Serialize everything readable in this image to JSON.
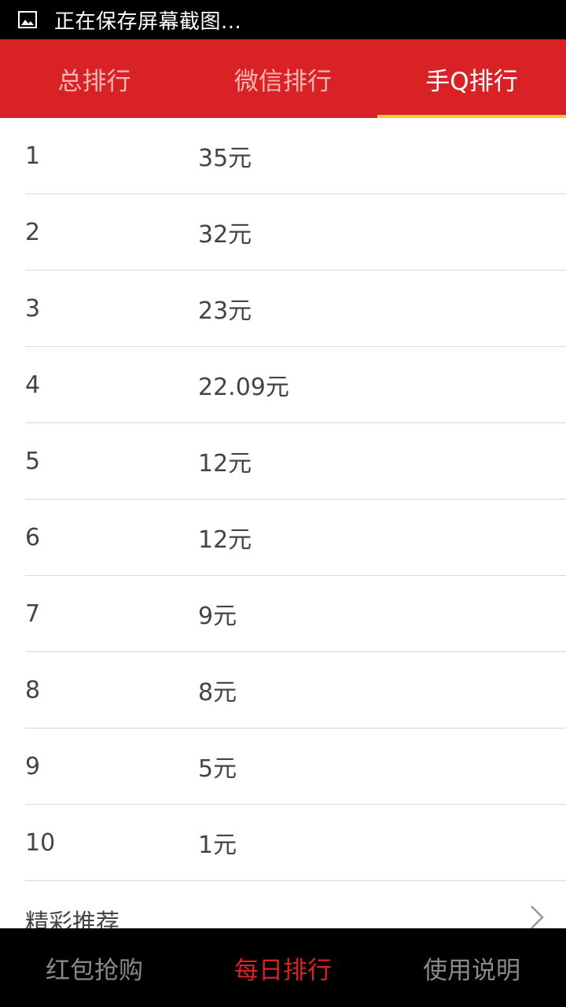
{
  "status_bar": {
    "icon": "image-icon",
    "text": "正在保存屏幕截图..."
  },
  "tabs": [
    {
      "label": "总排行",
      "active": false
    },
    {
      "label": "微信排行",
      "active": false
    },
    {
      "label": "手Q排行",
      "active": true
    }
  ],
  "ranking": [
    {
      "rank": "1",
      "amount": "35元"
    },
    {
      "rank": "2",
      "amount": "32元"
    },
    {
      "rank": "3",
      "amount": "23元"
    },
    {
      "rank": "4",
      "amount": "22.09元"
    },
    {
      "rank": "5",
      "amount": "12元"
    },
    {
      "rank": "6",
      "amount": "12元"
    },
    {
      "rank": "7",
      "amount": "9元"
    },
    {
      "rank": "8",
      "amount": "8元"
    },
    {
      "rank": "9",
      "amount": "5元"
    },
    {
      "rank": "10",
      "amount": "1元"
    }
  ],
  "recommend": {
    "label": "精彩推荐",
    "icon": "chevron-right-icon"
  },
  "bottom_nav": [
    {
      "label": "红包抢购",
      "active": false
    },
    {
      "label": "每日排行",
      "active": true
    },
    {
      "label": "使用说明",
      "active": false
    }
  ],
  "colors": {
    "accent": "#d92226",
    "tab_indicator": "#f5c842",
    "inactive_tab_text": "#f6b5b5",
    "bottom_inactive": "#8a8a8a"
  }
}
